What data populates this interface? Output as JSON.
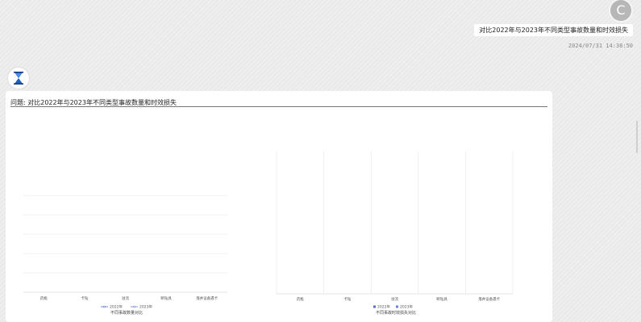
{
  "user": {
    "avatar_letter": "C",
    "message": "对比2022年与2023年不同类型事故数量和时效损失",
    "timestamp": "2024/07/31 14:38:50"
  },
  "bot": {
    "avatar_icon": "hourglass-logo-icon"
  },
  "response": {
    "question_label": "问题: 对比2022年与2023年不同类型事故数量和时效损失"
  },
  "colors": {
    "series_2022": "#5470c6",
    "series_2023": "#6a7fd6",
    "grid": "#e6e6e6"
  },
  "chart_data": [
    {
      "type": "line",
      "title": "不同事故数量对比",
      "categories": [
        "药瓶",
        "卡钻",
        "溢流",
        "断钻具",
        "落井设备遇卡"
      ],
      "series": [
        {
          "name": "2022年",
          "values": [
            0,
            0,
            0,
            0,
            0
          ]
        },
        {
          "name": "2023年",
          "values": [
            0,
            0,
            0,
            0,
            0
          ]
        }
      ],
      "grid": true,
      "legend": "bottom"
    },
    {
      "type": "bar",
      "title": "不同事故时效损失对比",
      "categories": [
        "药瓶",
        "卡钻",
        "溢流",
        "断钻具",
        "落井设备遇卡"
      ],
      "series": [
        {
          "name": "2022年",
          "values": [
            0,
            0,
            0,
            0,
            0
          ]
        },
        {
          "name": "2023年",
          "values": [
            0,
            0,
            0,
            0,
            0
          ]
        }
      ],
      "grid": true,
      "legend": "bottom"
    }
  ]
}
